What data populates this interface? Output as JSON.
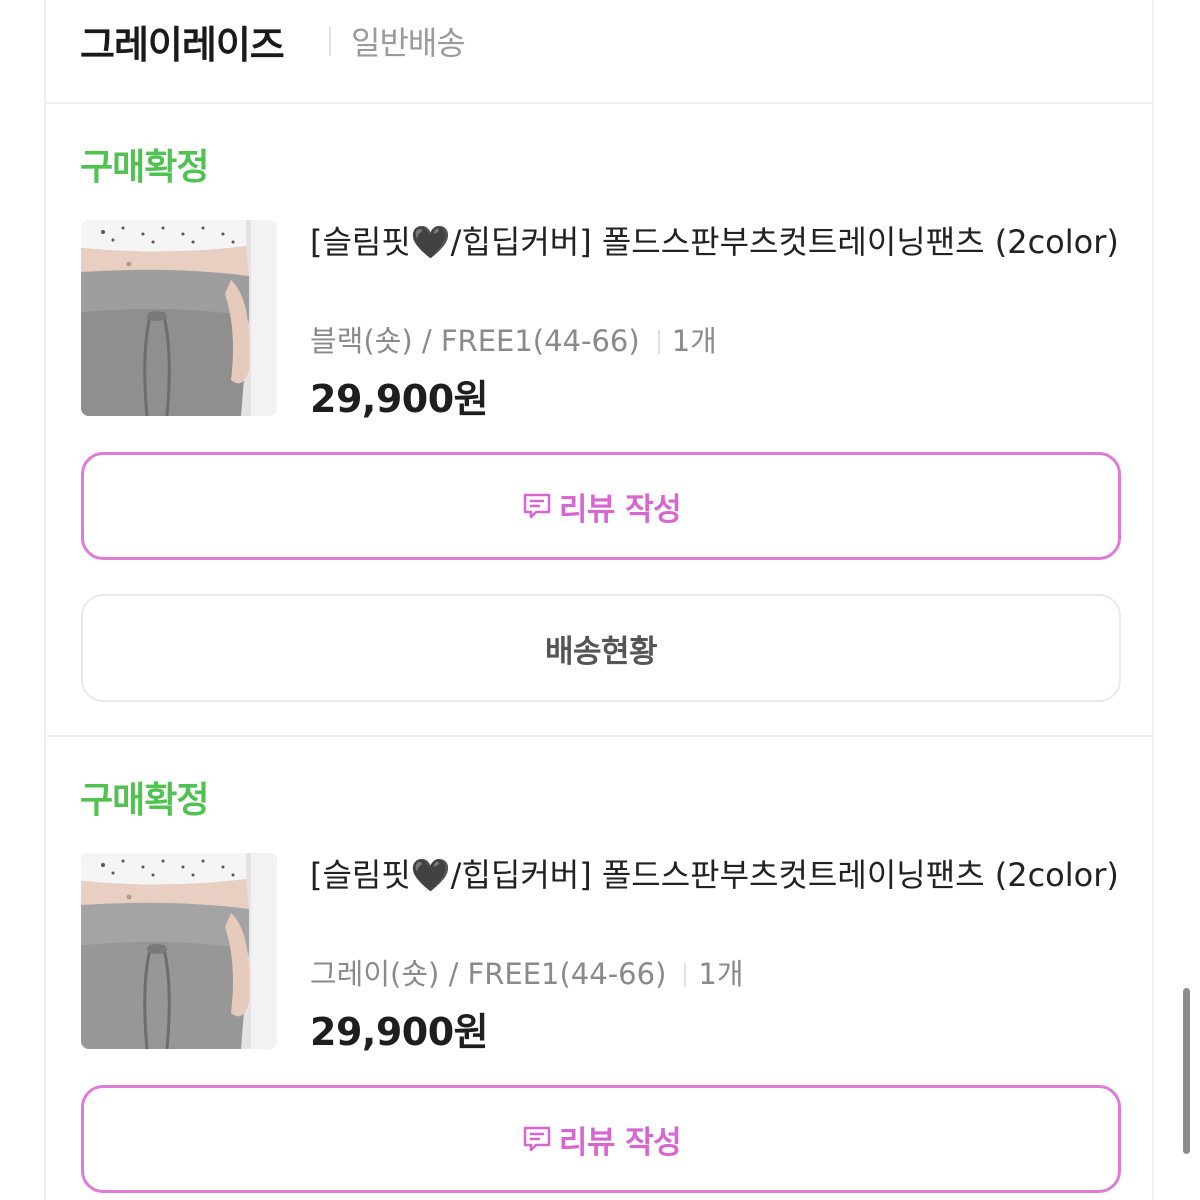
{
  "store": {
    "name": "그레이레이즈",
    "shipping_type": "일반배송"
  },
  "orders": [
    {
      "status": "구매확정",
      "product_name_prefix": "[슬림핏",
      "product_heart": "🖤",
      "product_name_suffix": "/힙딥커버] 폴드스판부츠컷트레이닝팬츠 (2color)",
      "option": "블랙(숏) / FREE1(44-66)",
      "quantity": "1개",
      "price": "29,900원",
      "review_button": "리뷰 작성",
      "tracking_button": "배송현황"
    },
    {
      "status": "구매확정",
      "product_name_prefix": "[슬림핏",
      "product_heart": "🖤",
      "product_name_suffix": "/힙딥커버] 폴드스판부츠컷트레이닝팬츠 (2color)",
      "option": "그레이(숏) / FREE1(44-66)",
      "quantity": "1개",
      "price": "29,900원",
      "review_button": "리뷰 작성"
    }
  ],
  "colors": {
    "status_green": "#4fc24f",
    "review_pink": "#d966d0",
    "border_gray": "#efefef"
  },
  "icons": {
    "review": "speech-bubble-icon",
    "product": "product-thumbnail"
  }
}
